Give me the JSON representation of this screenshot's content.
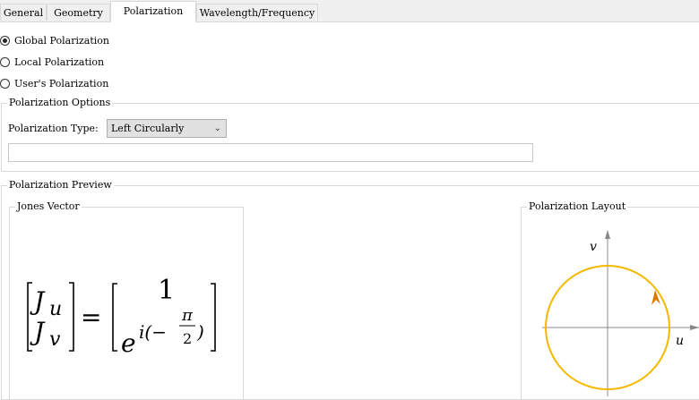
{
  "tabs": [
    {
      "label": "General"
    },
    {
      "label": "Geometry"
    },
    {
      "label": "Polarization"
    },
    {
      "label": "Wavelength/Frequency"
    }
  ],
  "polarization_mode": {
    "options": [
      {
        "label": "Global Polarization",
        "checked": true
      },
      {
        "label": "Local Polarization",
        "checked": false
      },
      {
        "label": "User's Polarization",
        "checked": false
      }
    ]
  },
  "options_group": {
    "title": "Polarization Options",
    "type_label": "Polarization Type:",
    "type_value": "Left Circularly",
    "extra_value": ""
  },
  "preview_group": {
    "title": "Polarization Preview",
    "jones": {
      "title": "Jones Vector",
      "lhs_top": "J",
      "lhs_top_sub": "u",
      "lhs_bottom": "J",
      "lhs_bottom_sub": "v",
      "equals": "=",
      "rhs_top": "1",
      "rhs_base": "e",
      "rhs_exp_prefix": "i(−",
      "rhs_frac_num": "π",
      "rhs_frac_den": "2",
      "rhs_exp_suffix": ")"
    },
    "layout": {
      "title": "Polarization Layout",
      "v_axis": "v",
      "u_axis": "u",
      "circle_color": "#f5b800",
      "arrow_color": "#d97a00",
      "axis_color": "#888888"
    }
  }
}
